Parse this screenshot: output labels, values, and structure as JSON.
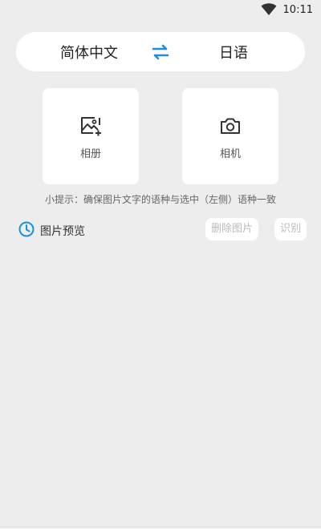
{
  "status_bar": {
    "time": "10:11",
    "wifi_icon": "wifi-icon"
  },
  "language_bar": {
    "source": "简体中文",
    "target": "日语",
    "swap_icon": "swap-arrows-icon",
    "accent": "#1a8fe0"
  },
  "tiles": {
    "album": {
      "label": "相册",
      "icon": "image-add-icon"
    },
    "camera": {
      "label": "相机",
      "icon": "camera-icon"
    }
  },
  "tip": "小提示：确保图片文字的语种与选中（左侧）语种一致",
  "preview": {
    "title": "图片预览",
    "icon": "clock-icon",
    "delete_label": "删除图片",
    "recognize_label": "识别"
  }
}
